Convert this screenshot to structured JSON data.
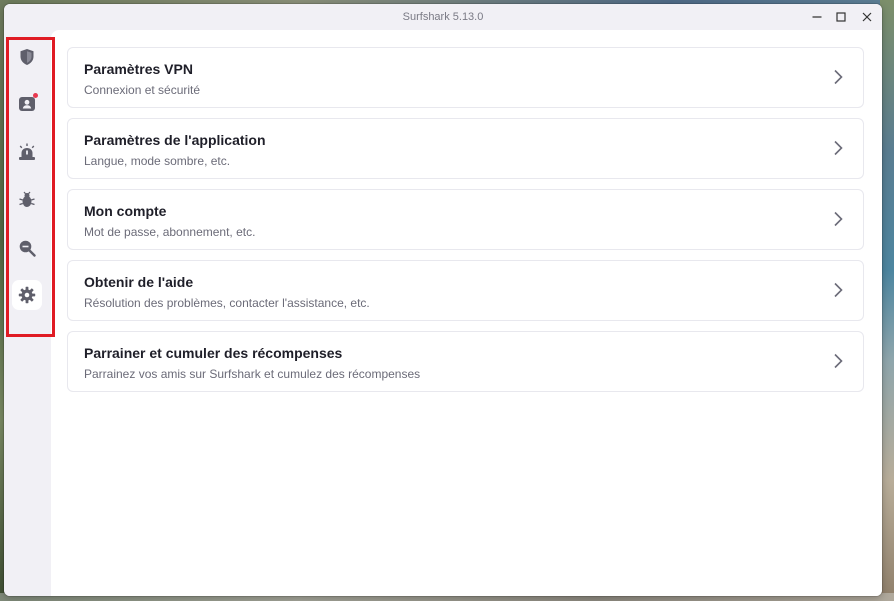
{
  "window": {
    "title": "Surfshark 5.13.0"
  },
  "sidebar": {
    "items": [
      {
        "name": "vpn",
        "icon": "shield-icon"
      },
      {
        "name": "account",
        "icon": "user-icon",
        "has_notification": true
      },
      {
        "name": "alert",
        "icon": "alert-icon"
      },
      {
        "name": "antivirus",
        "icon": "bug-icon"
      },
      {
        "name": "search",
        "icon": "search-icon"
      },
      {
        "name": "settings",
        "icon": "gear-icon",
        "active": true
      }
    ]
  },
  "settings": {
    "items": [
      {
        "title": "Paramètres VPN",
        "subtitle": "Connexion et sécurité"
      },
      {
        "title": "Paramètres de l'application",
        "subtitle": "Langue, mode sombre, etc."
      },
      {
        "title": "Mon compte",
        "subtitle": "Mot de passe, abonnement, etc."
      },
      {
        "title": "Obtenir de l'aide",
        "subtitle": "Résolution des problèmes, contacter l'assistance, etc."
      },
      {
        "title": "Parrainer et cumuler des récompenses",
        "subtitle": "Parrainez vos amis sur Surfshark et cumulez des récompenses"
      }
    ]
  },
  "colors": {
    "highlight": "#e01b24",
    "notification": "#e8384f",
    "sidebar_bg": "#f1f0f5",
    "icon": "#5f5f6b"
  }
}
